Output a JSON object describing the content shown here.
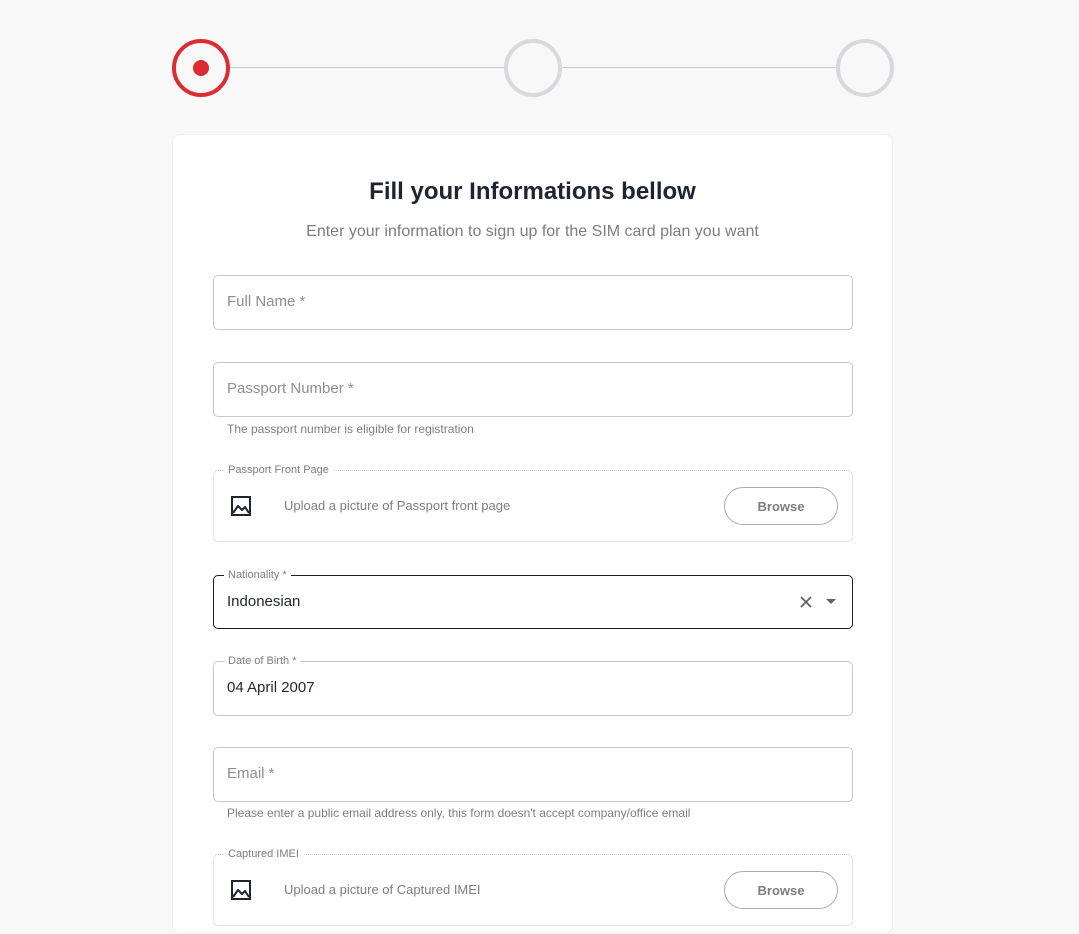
{
  "stepper": {
    "steps": [
      {
        "state": "active"
      },
      {
        "state": "inactive"
      },
      {
        "state": "inactive"
      }
    ],
    "active_color": "#dc2c33",
    "inactive_color": "#d7d9dd"
  },
  "form": {
    "title": "Fill your Informations bellow",
    "subtitle": "Enter your information to sign up for the SIM card plan you want",
    "full_name": {
      "placeholder": "Full Name *",
      "value": ""
    },
    "passport_number": {
      "placeholder": "Passport Number *",
      "value": "",
      "helper": "The passport number is eligible for registration"
    },
    "passport_front_page": {
      "legend": "Passport Front Page",
      "text": "Upload a picture of Passport front page",
      "icon": "image-icon",
      "button_label": "Browse"
    },
    "nationality": {
      "legend": "Nationality *",
      "value": "Indonesian",
      "clear_icon": "close-icon",
      "dropdown_icon": "caret-down-icon"
    },
    "date_of_birth": {
      "legend": "Date of Birth *",
      "value": "04 April 2007"
    },
    "email": {
      "placeholder": "Email *",
      "value": "",
      "helper": "Please enter a public email address only, this form doesn't accept company/office email"
    },
    "captured_imei": {
      "legend": "Captured IMEI",
      "text": "Upload a picture of Captured IMEI",
      "icon": "image-icon",
      "button_label": "Browse"
    }
  }
}
